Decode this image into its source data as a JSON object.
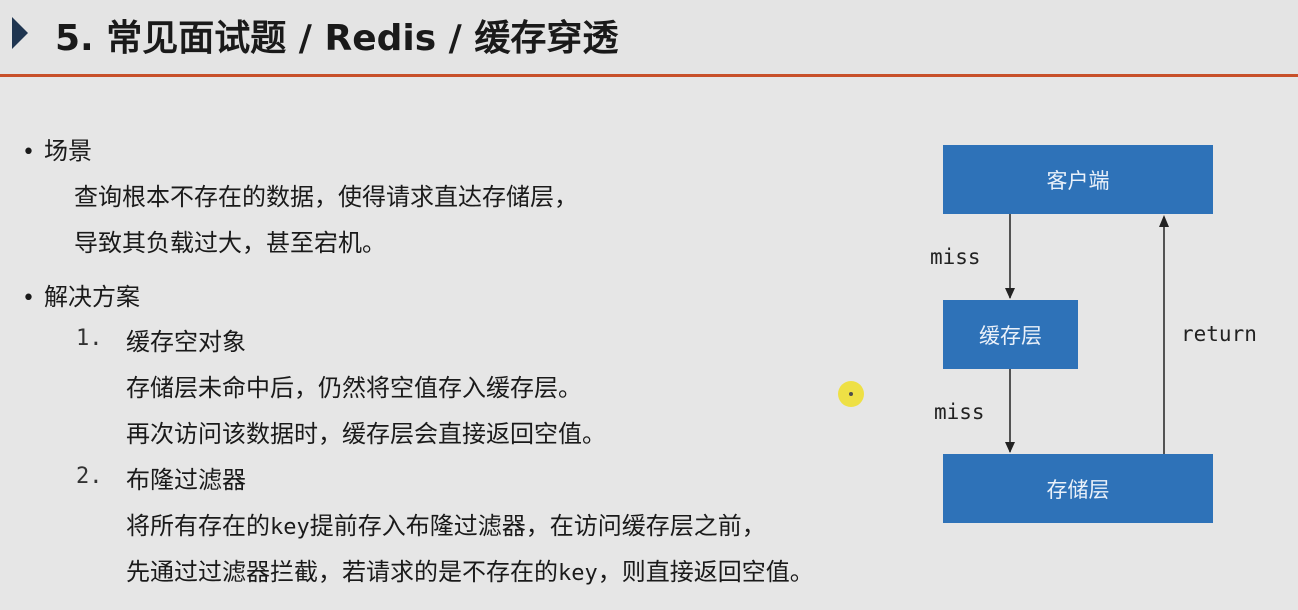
{
  "header": {
    "title": "5. 常见面试题 / Redis / 缓存穿透"
  },
  "content": {
    "scene": {
      "heading": "场景",
      "lines": [
        "查询根本不存在的数据，使得请求直达存储层，",
        "导致其负载过大，甚至宕机。"
      ]
    },
    "solution": {
      "heading": "解决方案",
      "items": [
        {
          "num": "1.",
          "title": "缓存空对象",
          "lines": [
            "存储层未命中后，仍然将空值存入缓存层。",
            "再次访问该数据时，缓存层会直接返回空值。"
          ]
        },
        {
          "num": "2.",
          "title": "布隆过滤器",
          "line1_a": "将所有存在的",
          "line1_key": "key",
          "line1_b": "提前存入布隆过滤器，在访问缓存层之前，",
          "line2_a": "先通过过滤器拦截，若请求的是不存在的",
          "line2_key": "key",
          "line2_b": "，则直接返回空值。"
        }
      ]
    }
  },
  "diagram": {
    "client": "客户端",
    "cache": "缓存层",
    "storage": "存储层",
    "miss1": "miss",
    "miss2": "miss",
    "return": "return",
    "box_color": "#2e72b8"
  },
  "bullet_char": "•"
}
